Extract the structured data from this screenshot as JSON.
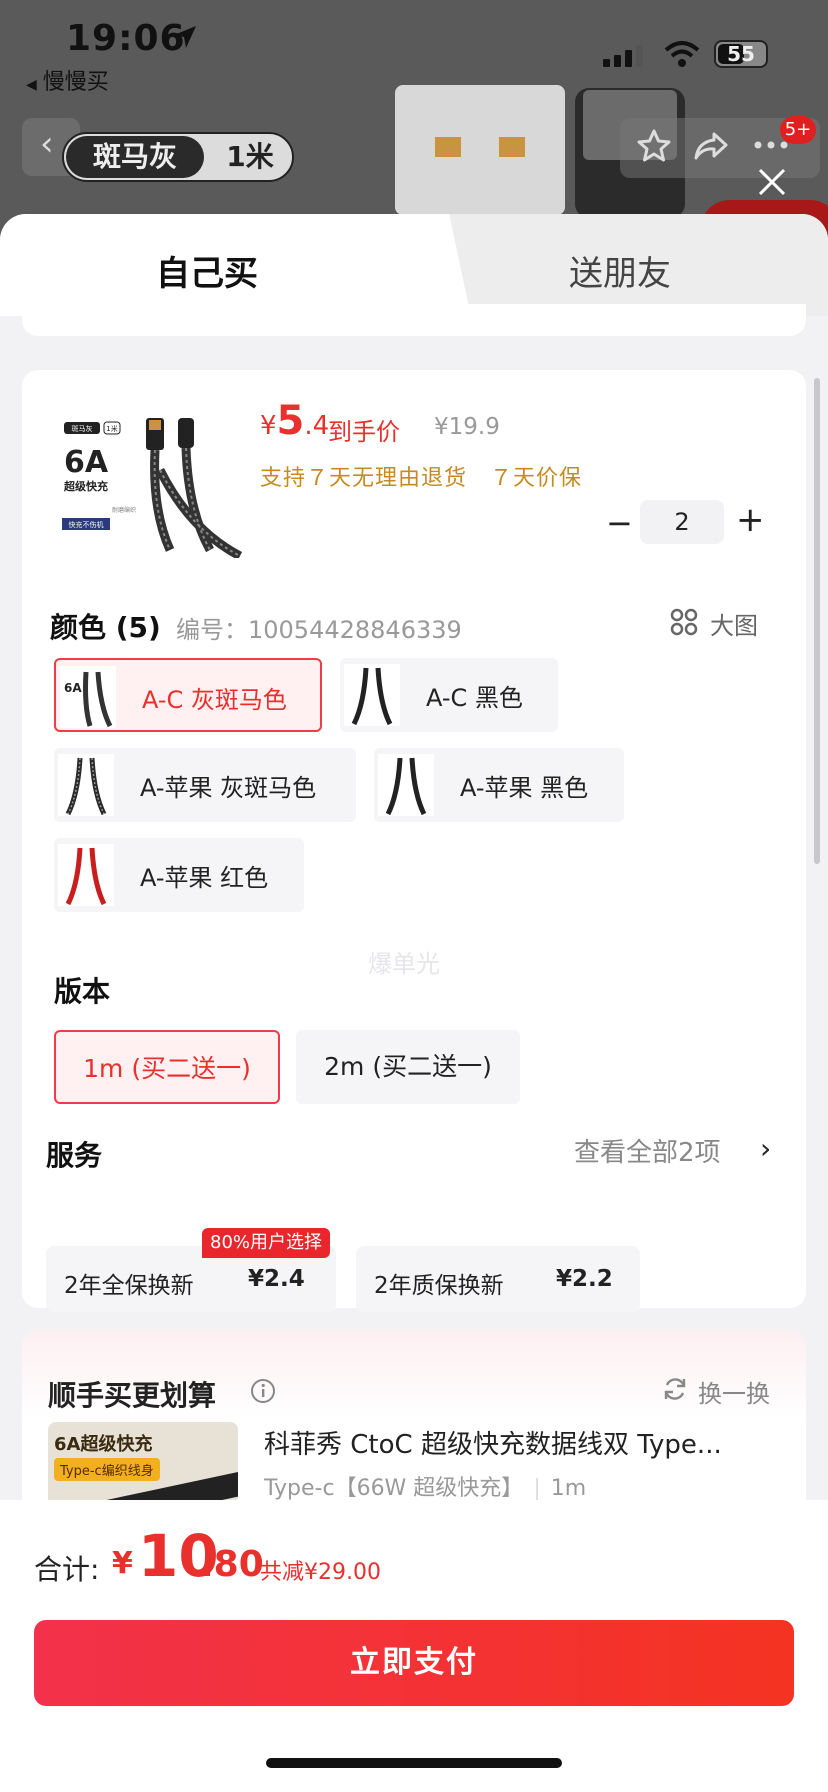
{
  "status_bar": {
    "time": "19:06",
    "back_app": "慢慢买",
    "battery": "55"
  },
  "product_header": {
    "variant_color": "斑马灰",
    "variant_length": "1米",
    "cart_badge": "5+"
  },
  "tabs": [
    {
      "label": "自己买",
      "active": true
    },
    {
      "label": "送朋友",
      "active": false
    }
  ],
  "product": {
    "image_text": {
      "tag1": "斑马灰",
      "tag2": "1米",
      "big": "6A",
      "sub": "超级快充",
      "note": "耐磨编织",
      "foot": "快充不伤机"
    },
    "currency": "¥",
    "price_int": "5",
    "price_dec": ".4",
    "price_label": "到手价",
    "original_price": "¥19.9",
    "guarantees": "支持７天无理由退货　７天价保",
    "quantity": "2",
    "minus": "−",
    "plus": "+"
  },
  "color_section": {
    "title": "颜色 (5)",
    "sku_label": "编号：10054428846339",
    "big_image": "大图",
    "options": [
      {
        "label": "A-C 灰斑马色",
        "selected": true
      },
      {
        "label": "A-C 黑色",
        "selected": false
      },
      {
        "label": "A-苹果 灰斑马色",
        "selected": false
      },
      {
        "label": "A-苹果 黑色",
        "selected": false
      },
      {
        "label": "A-苹果 红色",
        "selected": false
      }
    ]
  },
  "watermark": "爆单光",
  "version_section": {
    "title": "版本",
    "options": [
      {
        "label": "1m (买二送一)",
        "selected": true
      },
      {
        "label": "2m (买二送一)",
        "selected": false
      }
    ]
  },
  "service_section": {
    "title": "服务",
    "see_all": "查看全部2项",
    "items": [
      {
        "label": "2年全保换新",
        "price": "¥2.4",
        "badge": "80%用户选择"
      },
      {
        "label": "2年质保换新",
        "price": "¥2.2"
      }
    ]
  },
  "recommend": {
    "title": "顺手买更划算",
    "swap": "换一换",
    "image_title": "6A超级快充",
    "image_tag": "Type-c编织线身",
    "name": "科菲秀 CtoC 超级快充数据线双 Type...",
    "spec": "Type-c【66W 超级快充】",
    "length": "1m"
  },
  "footer": {
    "total_label": "合计:",
    "currency": "¥",
    "total_int": "10",
    "total_dec": ".80",
    "savings": "共减¥29.00",
    "pay_button": "立即支付"
  },
  "colors": {
    "accent": "#e8302c",
    "guarantee": "#c68a1e",
    "pay_gradient_start": "#f3314a",
    "pay_gradient_end": "#f43322"
  }
}
